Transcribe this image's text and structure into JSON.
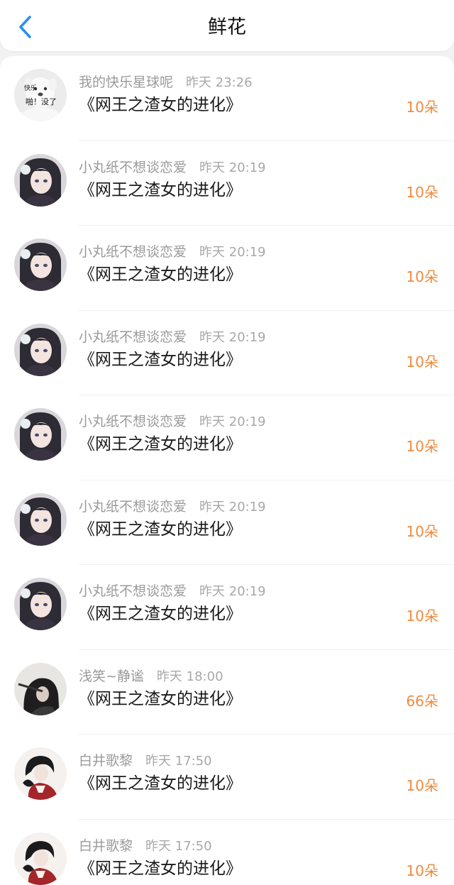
{
  "header": {
    "title": "鲜花",
    "back_icon": "chevron-left-icon",
    "accent_color": "#2b8ff0"
  },
  "count_color": "#f08a3c",
  "rows": [
    {
      "name": "我的快乐星球呢",
      "time": "昨天 23:26",
      "book": "《网王之渣女的进化》",
      "count": "10朵",
      "avatar": {
        "type": "dog",
        "text1": "快乐",
        "text2": "啪！没了"
      }
    },
    {
      "name": "小丸纸不想谈恋爱",
      "time": "昨天 20:19",
      "book": "《网王之渣女的进化》",
      "count": "10朵",
      "avatar": {
        "type": "anime"
      }
    },
    {
      "name": "小丸纸不想谈恋爱",
      "time": "昨天 20:19",
      "book": "《网王之渣女的进化》",
      "count": "10朵",
      "avatar": {
        "type": "anime"
      }
    },
    {
      "name": "小丸纸不想谈恋爱",
      "time": "昨天 20:19",
      "book": "《网王之渣女的进化》",
      "count": "10朵",
      "avatar": {
        "type": "anime"
      }
    },
    {
      "name": "小丸纸不想谈恋爱",
      "time": "昨天 20:19",
      "book": "《网王之渣女的进化》",
      "count": "10朵",
      "avatar": {
        "type": "anime"
      }
    },
    {
      "name": "小丸纸不想谈恋爱",
      "time": "昨天 20:19",
      "book": "《网王之渣女的进化》",
      "count": "10朵",
      "avatar": {
        "type": "anime"
      }
    },
    {
      "name": "小丸纸不想谈恋爱",
      "time": "昨天 20:19",
      "book": "《网王之渣女的进化》",
      "count": "10朵",
      "avatar": {
        "type": "anime"
      }
    },
    {
      "name": "浅笑~静谧",
      "time": "昨天 18:00",
      "book": "《网王之渣女的进化》",
      "count": "66朵",
      "avatar": {
        "type": "dark"
      }
    },
    {
      "name": "白井歌黎",
      "time": "昨天 17:50",
      "book": "《网王之渣女的进化》",
      "count": "10朵",
      "avatar": {
        "type": "red"
      }
    },
    {
      "name": "白井歌黎",
      "time": "昨天 17:50",
      "book": "《网王之渣女的进化》",
      "count": "10朵",
      "avatar": {
        "type": "red"
      }
    }
  ]
}
